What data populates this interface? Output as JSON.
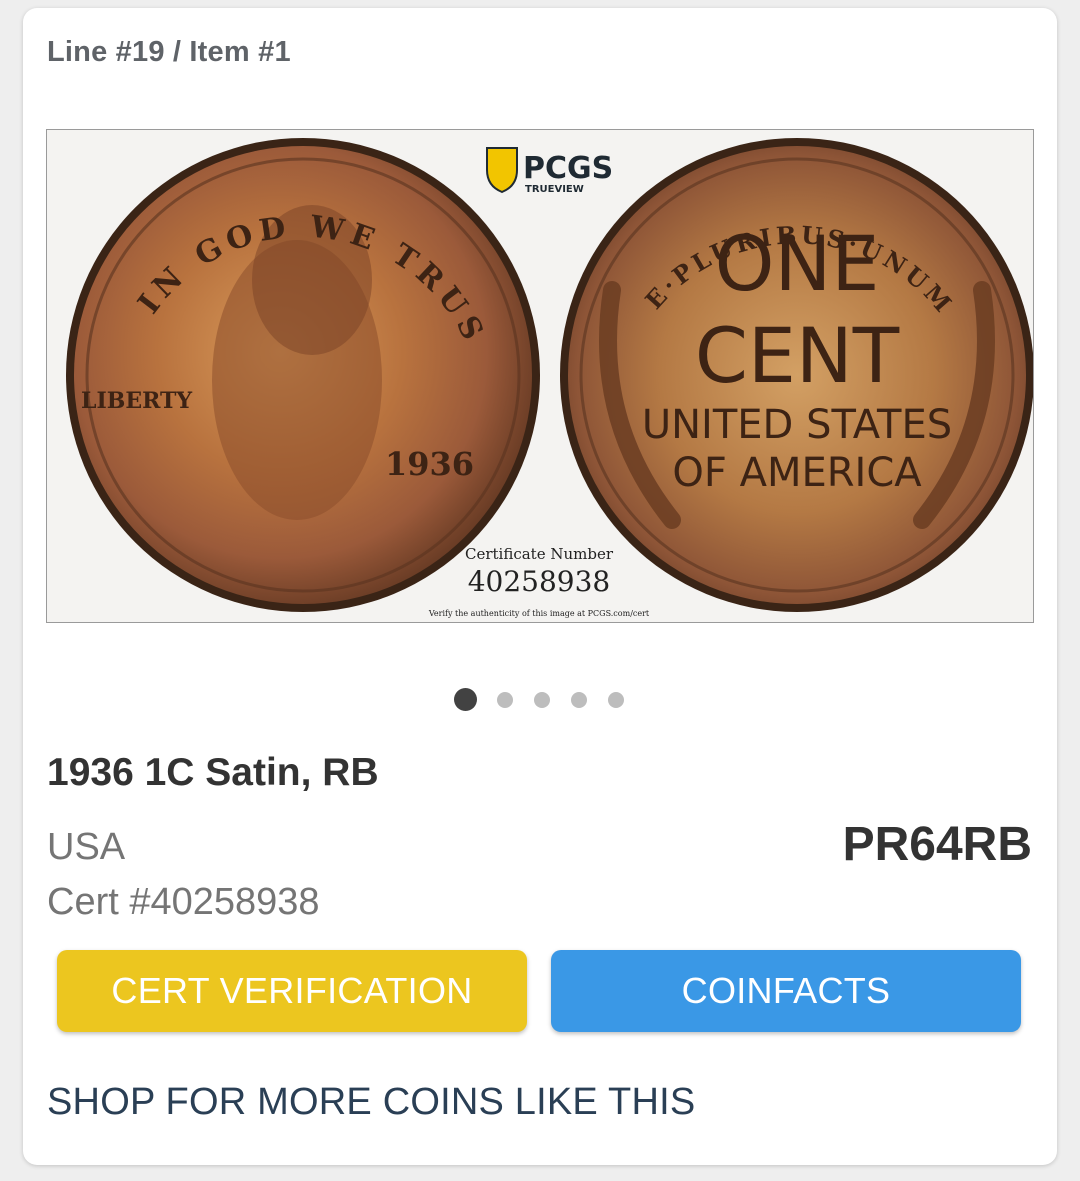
{
  "breadcrumb": "Line #19 / Item #1",
  "image": {
    "logo_text": "PCGS",
    "logo_subtext": "TRUEVIEW",
    "obverse": {
      "motto": "IN GOD WE TRUST",
      "liberty": "LIBERTY",
      "date": "1936"
    },
    "reverse": {
      "motto": "E·PLURIBUS·UNUM",
      "denomination_line1": "ONE",
      "denomination_line2": "CENT",
      "country_line1": "UNITED STATES",
      "country_line2": "OF AMERICA"
    },
    "certificate_label": "Certificate Number",
    "certificate_number": "40258938",
    "verify_text": "Verify the authenticity of this image at PCGS.com/cert"
  },
  "carousel": {
    "total": 5,
    "active_index": 0
  },
  "item": {
    "title": "1936 1C Satin, RB",
    "country": "USA",
    "cert": "Cert #40258938",
    "grade": "PR64RB"
  },
  "buttons": {
    "cert_verification": "CERT VERIFICATION",
    "coinfacts": "COINFACTS"
  },
  "shop_link": "SHOP FOR MORE COINS LIKE THIS",
  "colors": {
    "cert_button": "#ecc61f",
    "coinfacts_button": "#3a98e6",
    "dot_active": "#424242",
    "dot_inactive": "#bdbdbd",
    "shop_link": "#2a3f55"
  }
}
